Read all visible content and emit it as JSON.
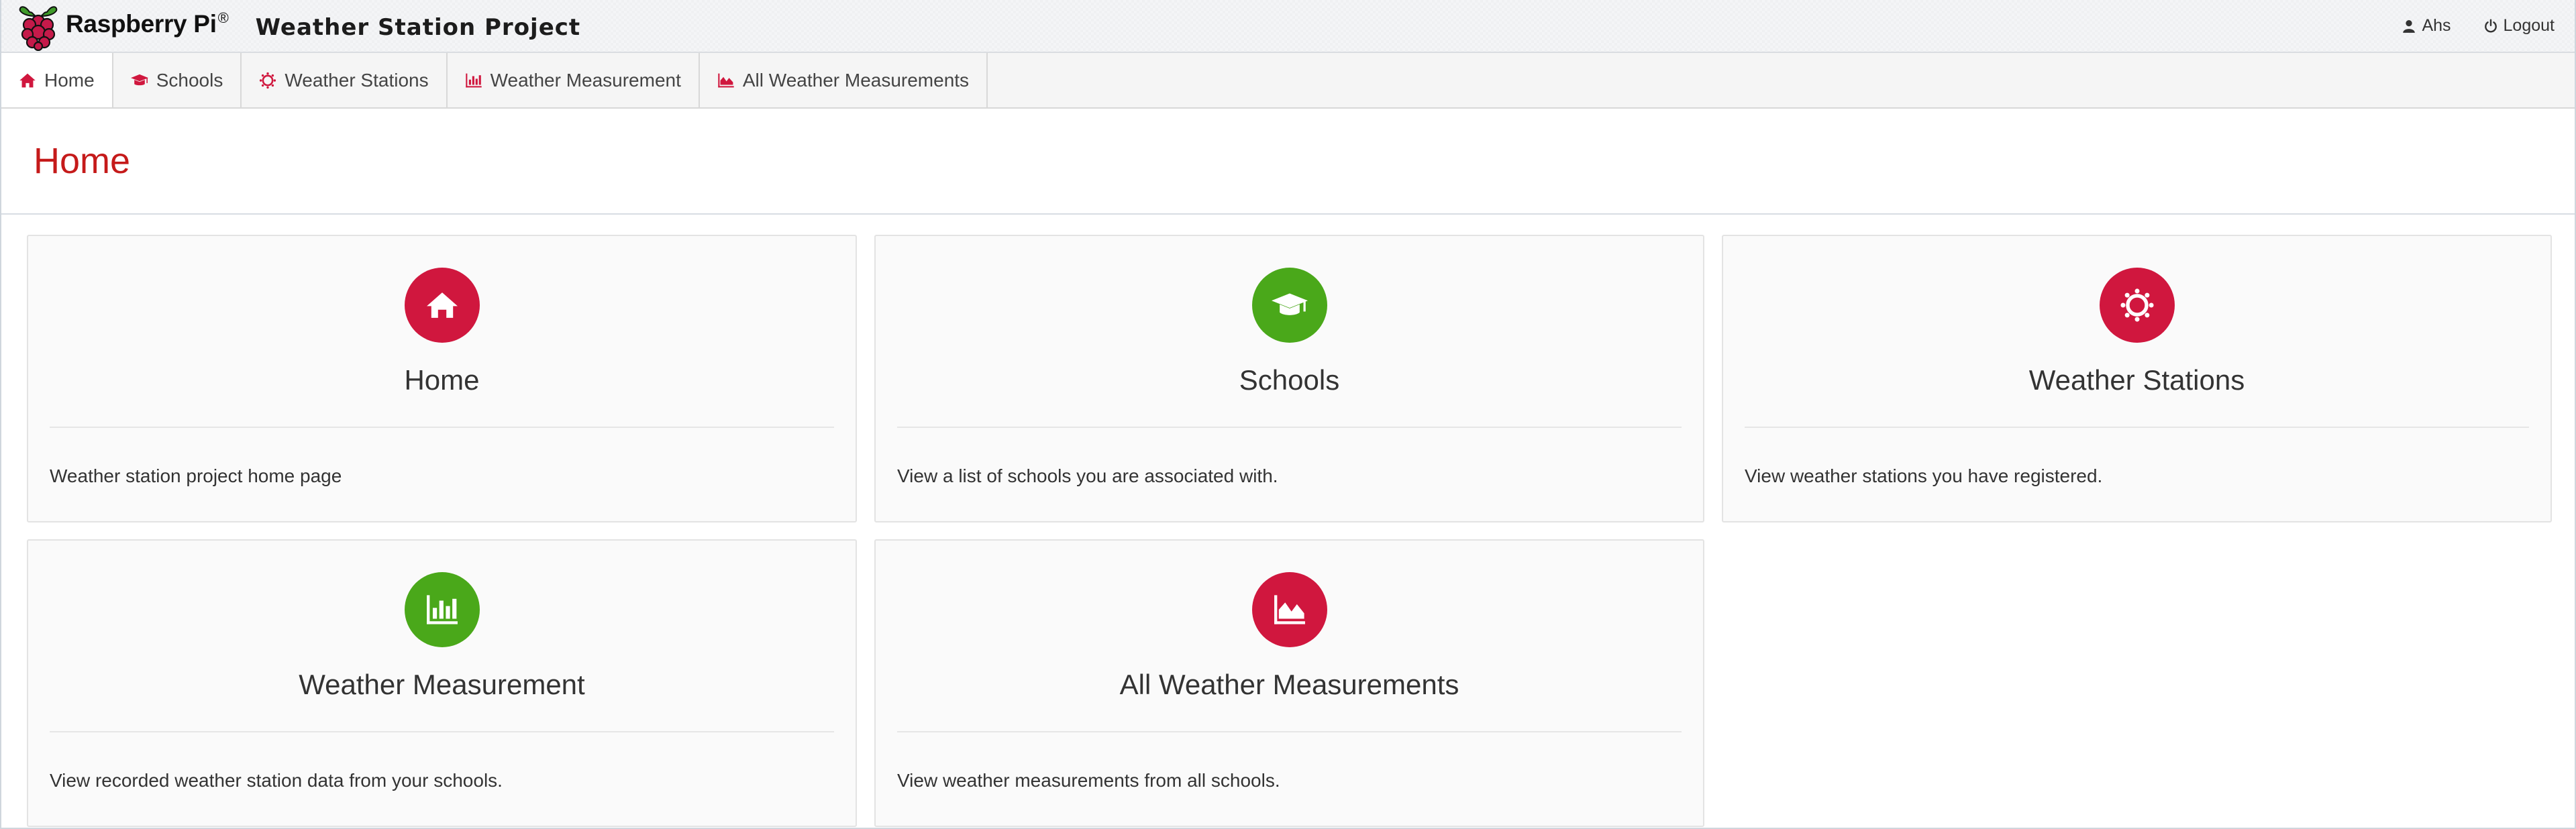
{
  "brand": {
    "name": "Raspberry Pi",
    "reg": "®"
  },
  "site_title": "Weather Station Project",
  "user": {
    "name": "Ahs",
    "logout": "Logout"
  },
  "nav": [
    {
      "label": "Home",
      "icon": "home-icon"
    },
    {
      "label": "Schools",
      "icon": "graduation-cap-icon"
    },
    {
      "label": "Weather Stations",
      "icon": "sun-icon"
    },
    {
      "label": "Weather Measurement",
      "icon": "bar-chart-icon"
    },
    {
      "label": "All Weather Measurements",
      "icon": "area-chart-icon"
    }
  ],
  "page_title": "Home",
  "colors": {
    "accent": "#c51a1a",
    "icon_red": "#d0173e",
    "icon_green": "#4aa81a"
  },
  "cards": [
    {
      "title": "Home",
      "description": "Weather station project home page",
      "icon": "home-icon",
      "color": "red"
    },
    {
      "title": "Schools",
      "description": "View a list of schools you are associated with.",
      "icon": "graduation-cap-icon",
      "color": "green"
    },
    {
      "title": "Weather Stations",
      "description": "View weather stations you have registered.",
      "icon": "sun-icon",
      "color": "red"
    },
    {
      "title": "Weather Measurement",
      "description": "View recorded weather station data from your schools.",
      "icon": "bar-chart-icon",
      "color": "green"
    },
    {
      "title": "All Weather Measurements",
      "description": "View weather measurements from all schools.",
      "icon": "area-chart-icon",
      "color": "red"
    }
  ]
}
